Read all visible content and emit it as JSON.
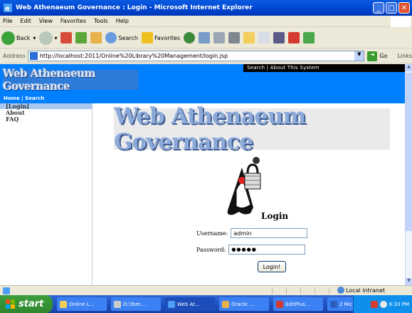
{
  "window": {
    "title": "Web Athenaeum Governance : Login - Microsoft Internet Explorer"
  },
  "menu": [
    "File",
    "Edit",
    "View",
    "Favorites",
    "Tools",
    "Help"
  ],
  "toolbar": {
    "back": "Back",
    "search": "Search",
    "favorites": "Favorites"
  },
  "address": {
    "label": "Address",
    "url": "http://localhost:2011/Online%20Library%20Management/login.jsp",
    "go": "Go",
    "links": "Links"
  },
  "header": {
    "top_links": "Search  |  About This System",
    "logo_text": "Web Athenaeum Governance",
    "nav": "Home  |  Search"
  },
  "sidebar": {
    "items": [
      "[Login]",
      "About",
      "FAQ"
    ]
  },
  "banner": {
    "text": "Web Athenaeum Governance"
  },
  "login": {
    "title": "Login",
    "username_label": "Username:",
    "username_value": "admin",
    "password_label": "Password:",
    "password_value": "●●●●●",
    "button": "Login!"
  },
  "statusbar": {
    "zone": "Local intranet"
  },
  "taskbar": {
    "start": "start",
    "tasks": [
      "Online L...",
      "D:\\Tom...",
      "Web At...",
      "Oracle ...",
      "EditPlus...",
      "2 Micr..."
    ],
    "clock": "6:33 PM"
  }
}
